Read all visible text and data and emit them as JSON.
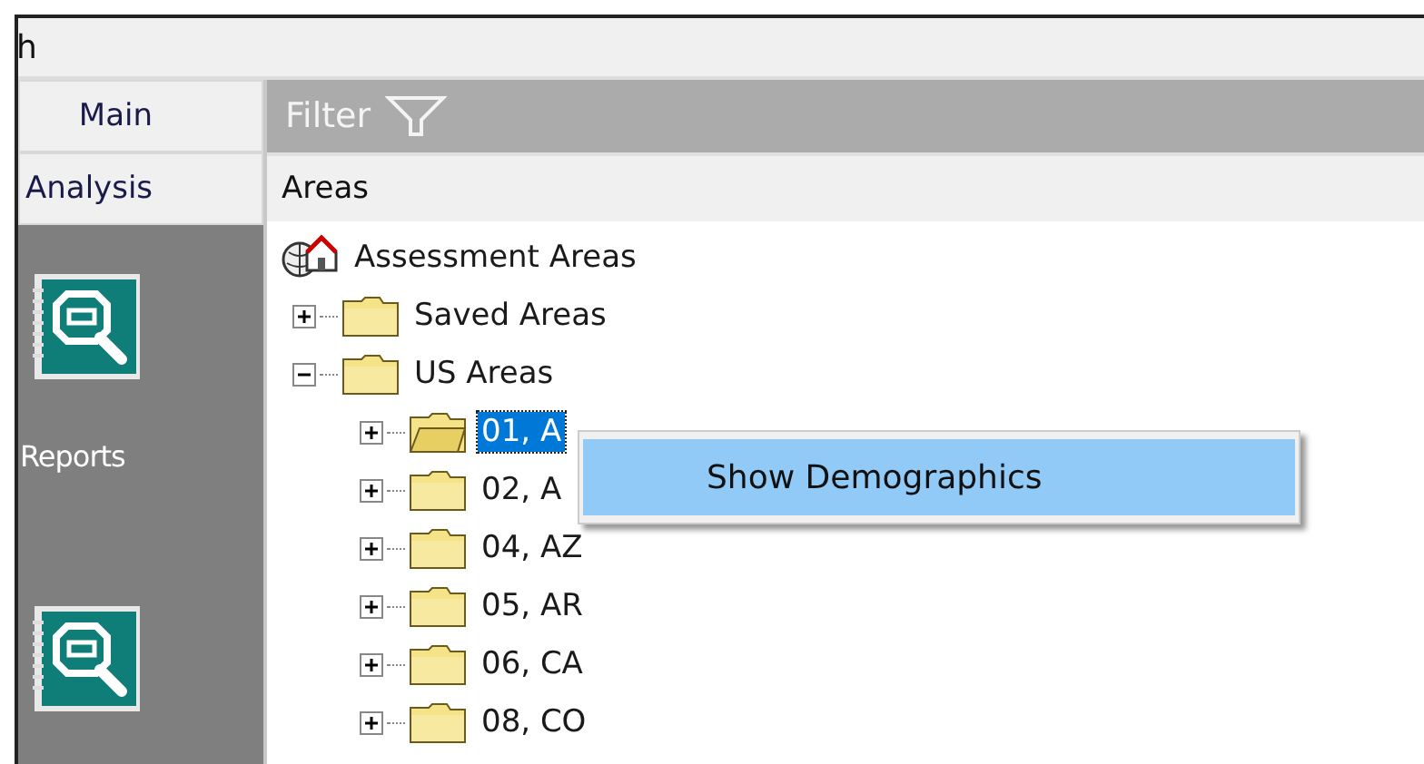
{
  "window": {
    "title": "h"
  },
  "nav_tabs": [
    {
      "label": "Main",
      "selected": false
    },
    {
      "label": "Analysis",
      "selected": false
    }
  ],
  "sidebar": {
    "items": [
      {
        "kind": "report",
        "label": "Reports"
      },
      {
        "kind": "report"
      }
    ]
  },
  "filter_bar": {
    "label": "Filter"
  },
  "panel": {
    "title": "Areas"
  },
  "tree": {
    "label": "Assessment Areas",
    "children": [
      {
        "label": "Saved Areas",
        "expanded": false,
        "selected": false
      },
      {
        "label": "US Areas",
        "expanded": true,
        "selected": false,
        "children": [
          {
            "label": "01, A",
            "expanded": false,
            "selected": true
          },
          {
            "label": "02, A",
            "expanded": false,
            "selected": false
          },
          {
            "label": "04, AZ",
            "expanded": false,
            "selected": false
          },
          {
            "label": "05, AR",
            "expanded": false,
            "selected": false
          },
          {
            "label": "06, CA",
            "expanded": false,
            "selected": false
          },
          {
            "label": "08, CO",
            "expanded": false,
            "selected": false
          }
        ]
      }
    ]
  },
  "context_menu": {
    "items": [
      {
        "label": "Show Demographics",
        "selected": true
      }
    ]
  }
}
